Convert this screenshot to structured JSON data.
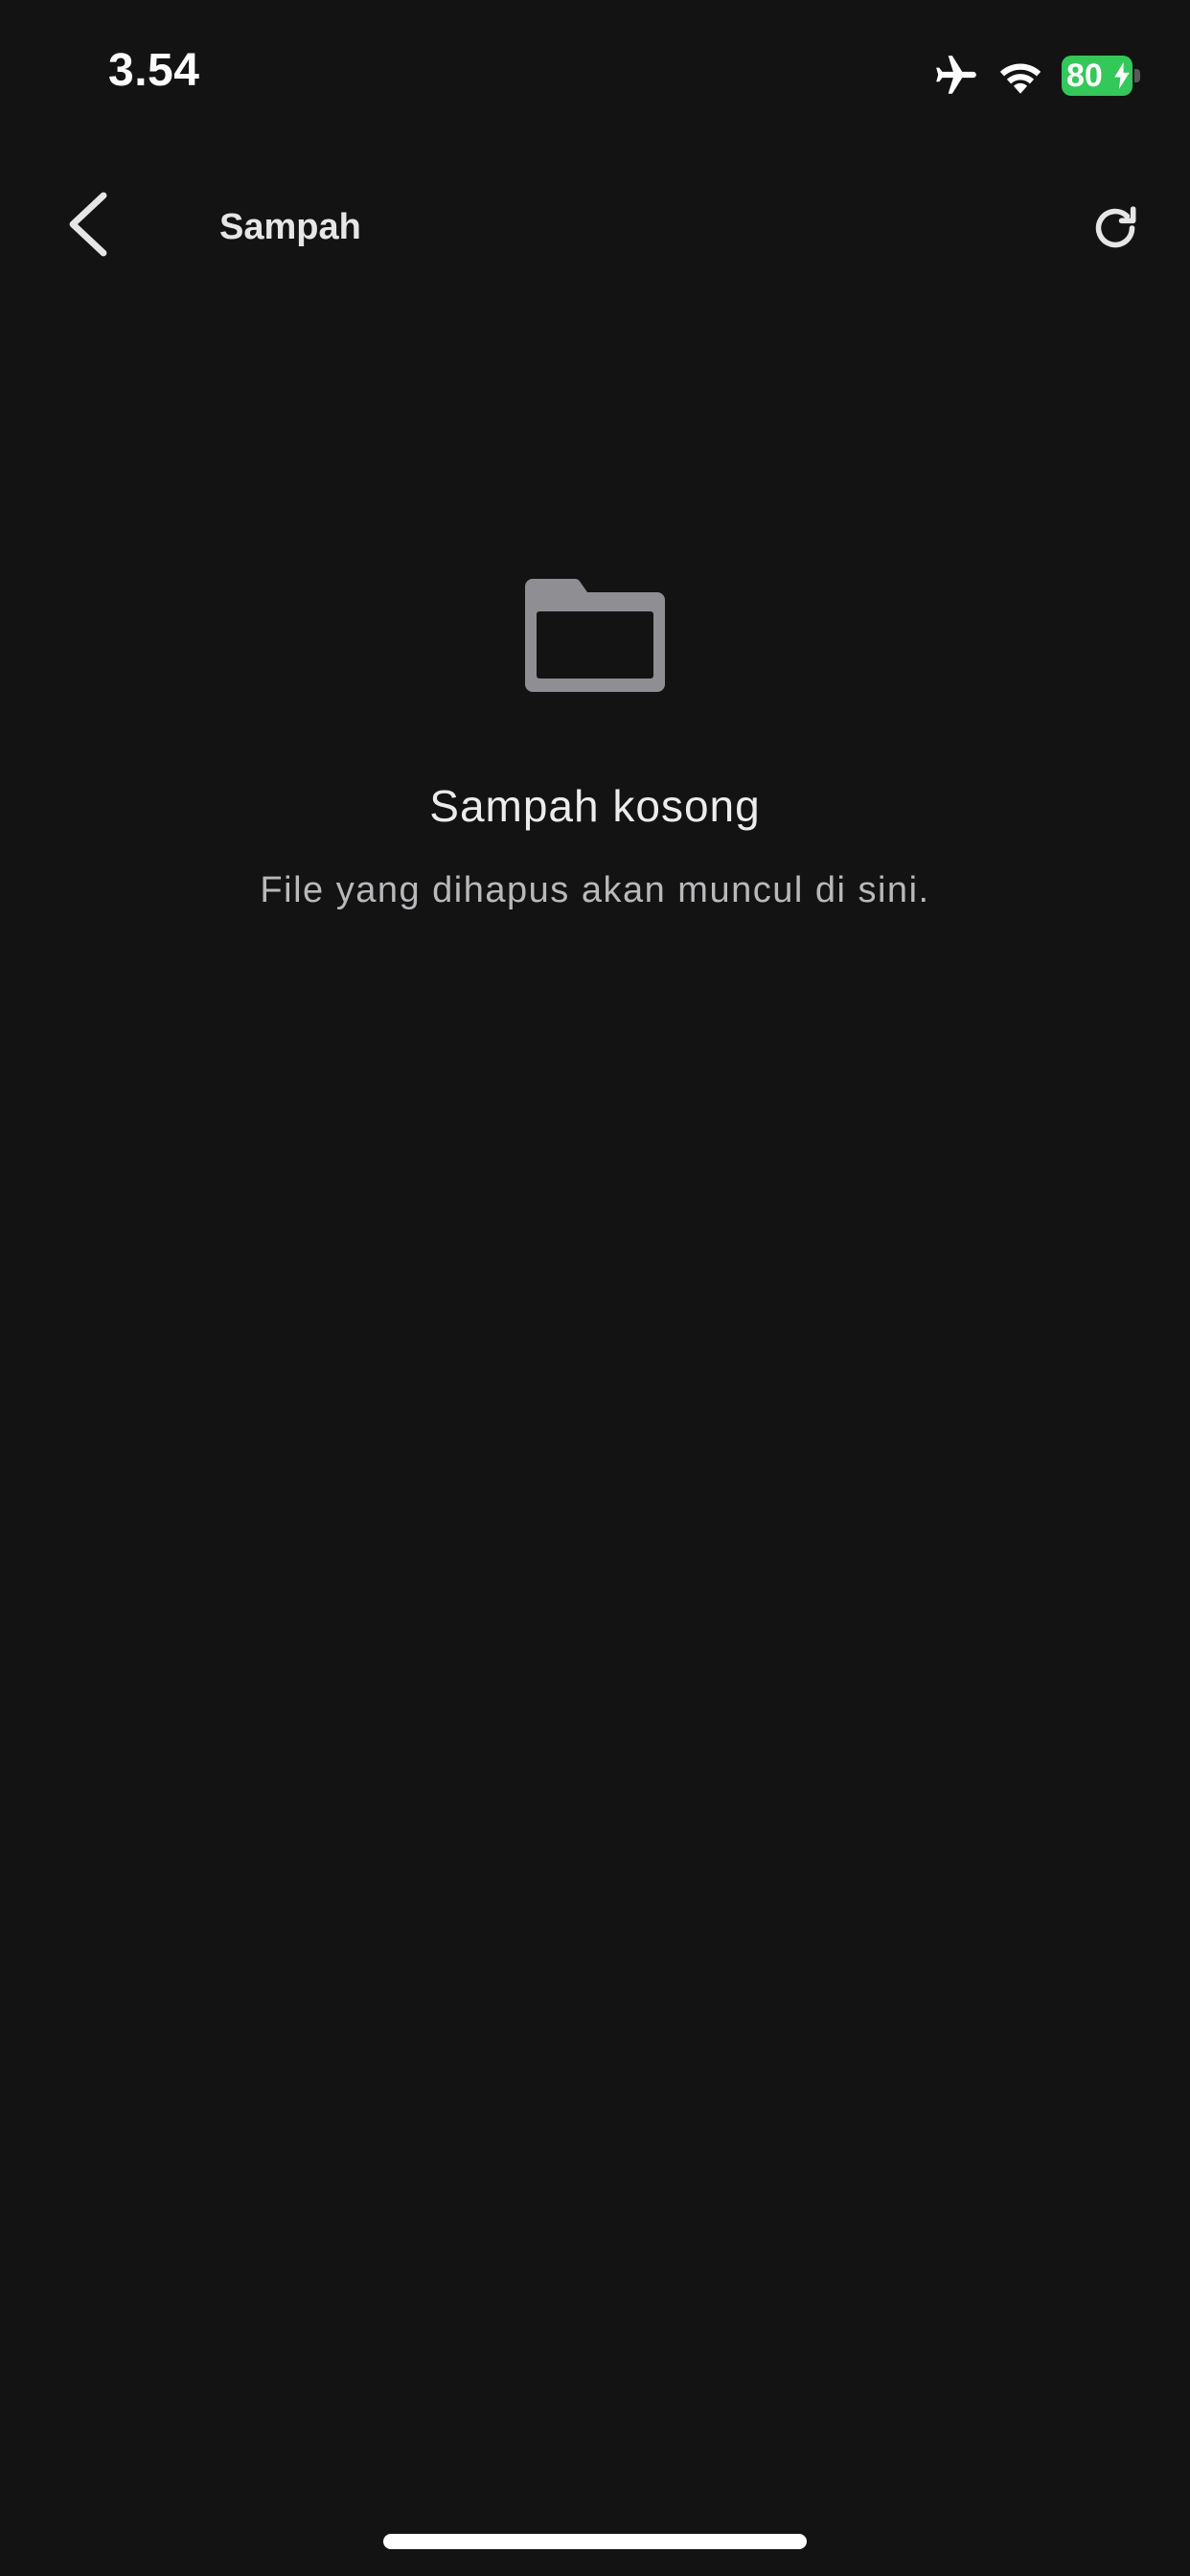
{
  "status_bar": {
    "time": "3.54",
    "battery_level": "80",
    "battery_color": "#34c759",
    "icons": [
      "airplane-icon",
      "wifi-icon",
      "battery-icon",
      "charging-bolt-icon"
    ]
  },
  "nav": {
    "title": "Sampah",
    "back_icon": "chevron-left-icon",
    "refresh_icon": "refresh-icon"
  },
  "empty_state": {
    "icon": "folder-icon",
    "icon_color": "#8e8e93",
    "title": "Sampah kosong",
    "subtitle": "File yang dihapus akan muncul di sini."
  },
  "theme": {
    "background": "#131313",
    "text": "#ffffff"
  }
}
